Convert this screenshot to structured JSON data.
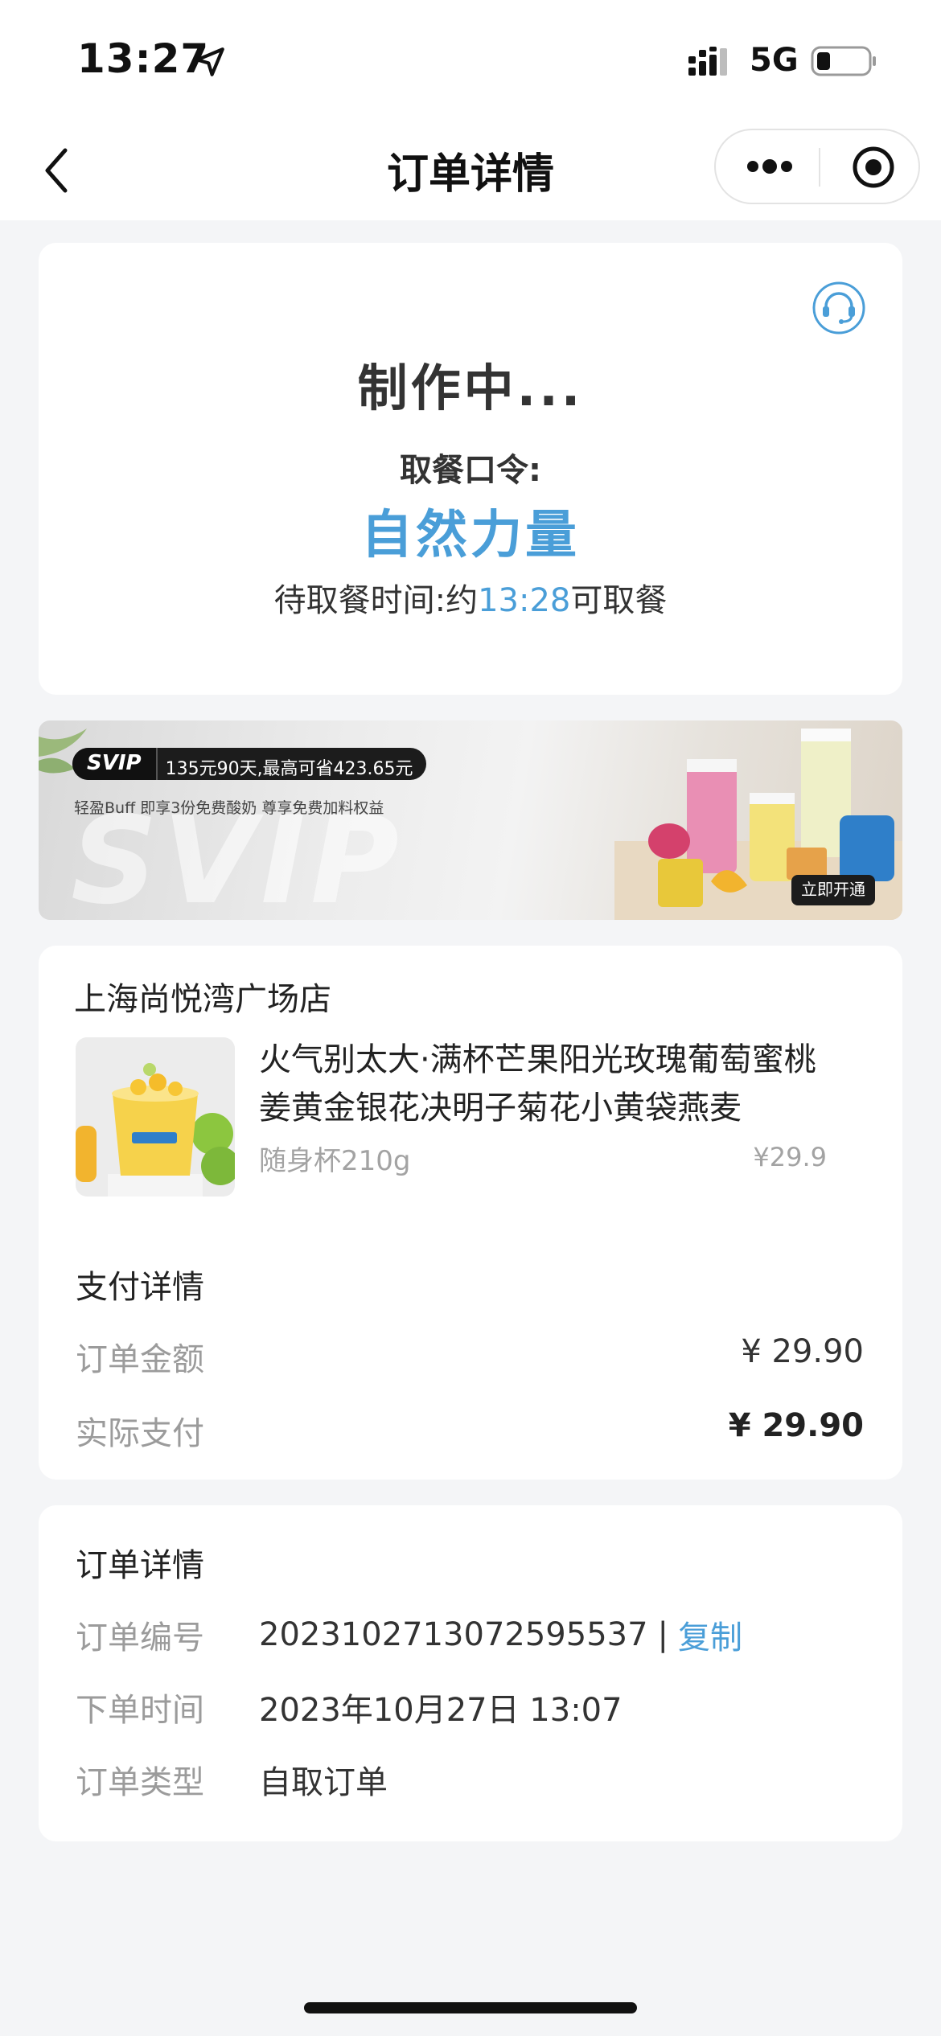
{
  "status_bar": {
    "time": "13:27",
    "network": "5G"
  },
  "nav": {
    "title": "订单详情"
  },
  "status": {
    "title": "制作中...",
    "code_label": "取餐口令:",
    "code_value": "自然力量",
    "pickup_prefix": "待取餐时间:约",
    "pickup_time": "13:28",
    "pickup_suffix": "可取餐"
  },
  "banner": {
    "tag": "SVIP",
    "pill_text": "135元90天,最高可省423.65元",
    "sub_text": "轻盈Buff  即享3份免费酸奶 尊享免费加料权益",
    "watermark": "SVIP",
    "open_label": "立即开通"
  },
  "store": {
    "name": "上海尚悦湾广场店"
  },
  "product": {
    "name": "火气别太大·满杯芒果阳光玫瑰葡萄蜜桃姜黄金银花决明子菊花小黄袋燕麦",
    "spec": "随身杯210g",
    "price": "¥29.9"
  },
  "payment": {
    "title": "支付详情",
    "amount_label": "订单金额",
    "amount_value": "¥ 29.90",
    "actual_label": "实际支付",
    "actual_value": "¥ 29.90"
  },
  "order": {
    "title": "订单详情",
    "no_label": "订单编号",
    "no_value": "2023102713072595537",
    "separator": "|",
    "copy_label": "复制",
    "time_label": "下单时间",
    "time_value": "2023年10月27日 13:07",
    "type_label": "订单类型",
    "type_value": "自取订单"
  },
  "colors": {
    "accent": "#4a9ed8",
    "muted": "#9b9b9b",
    "background": "#f4f5f7"
  }
}
